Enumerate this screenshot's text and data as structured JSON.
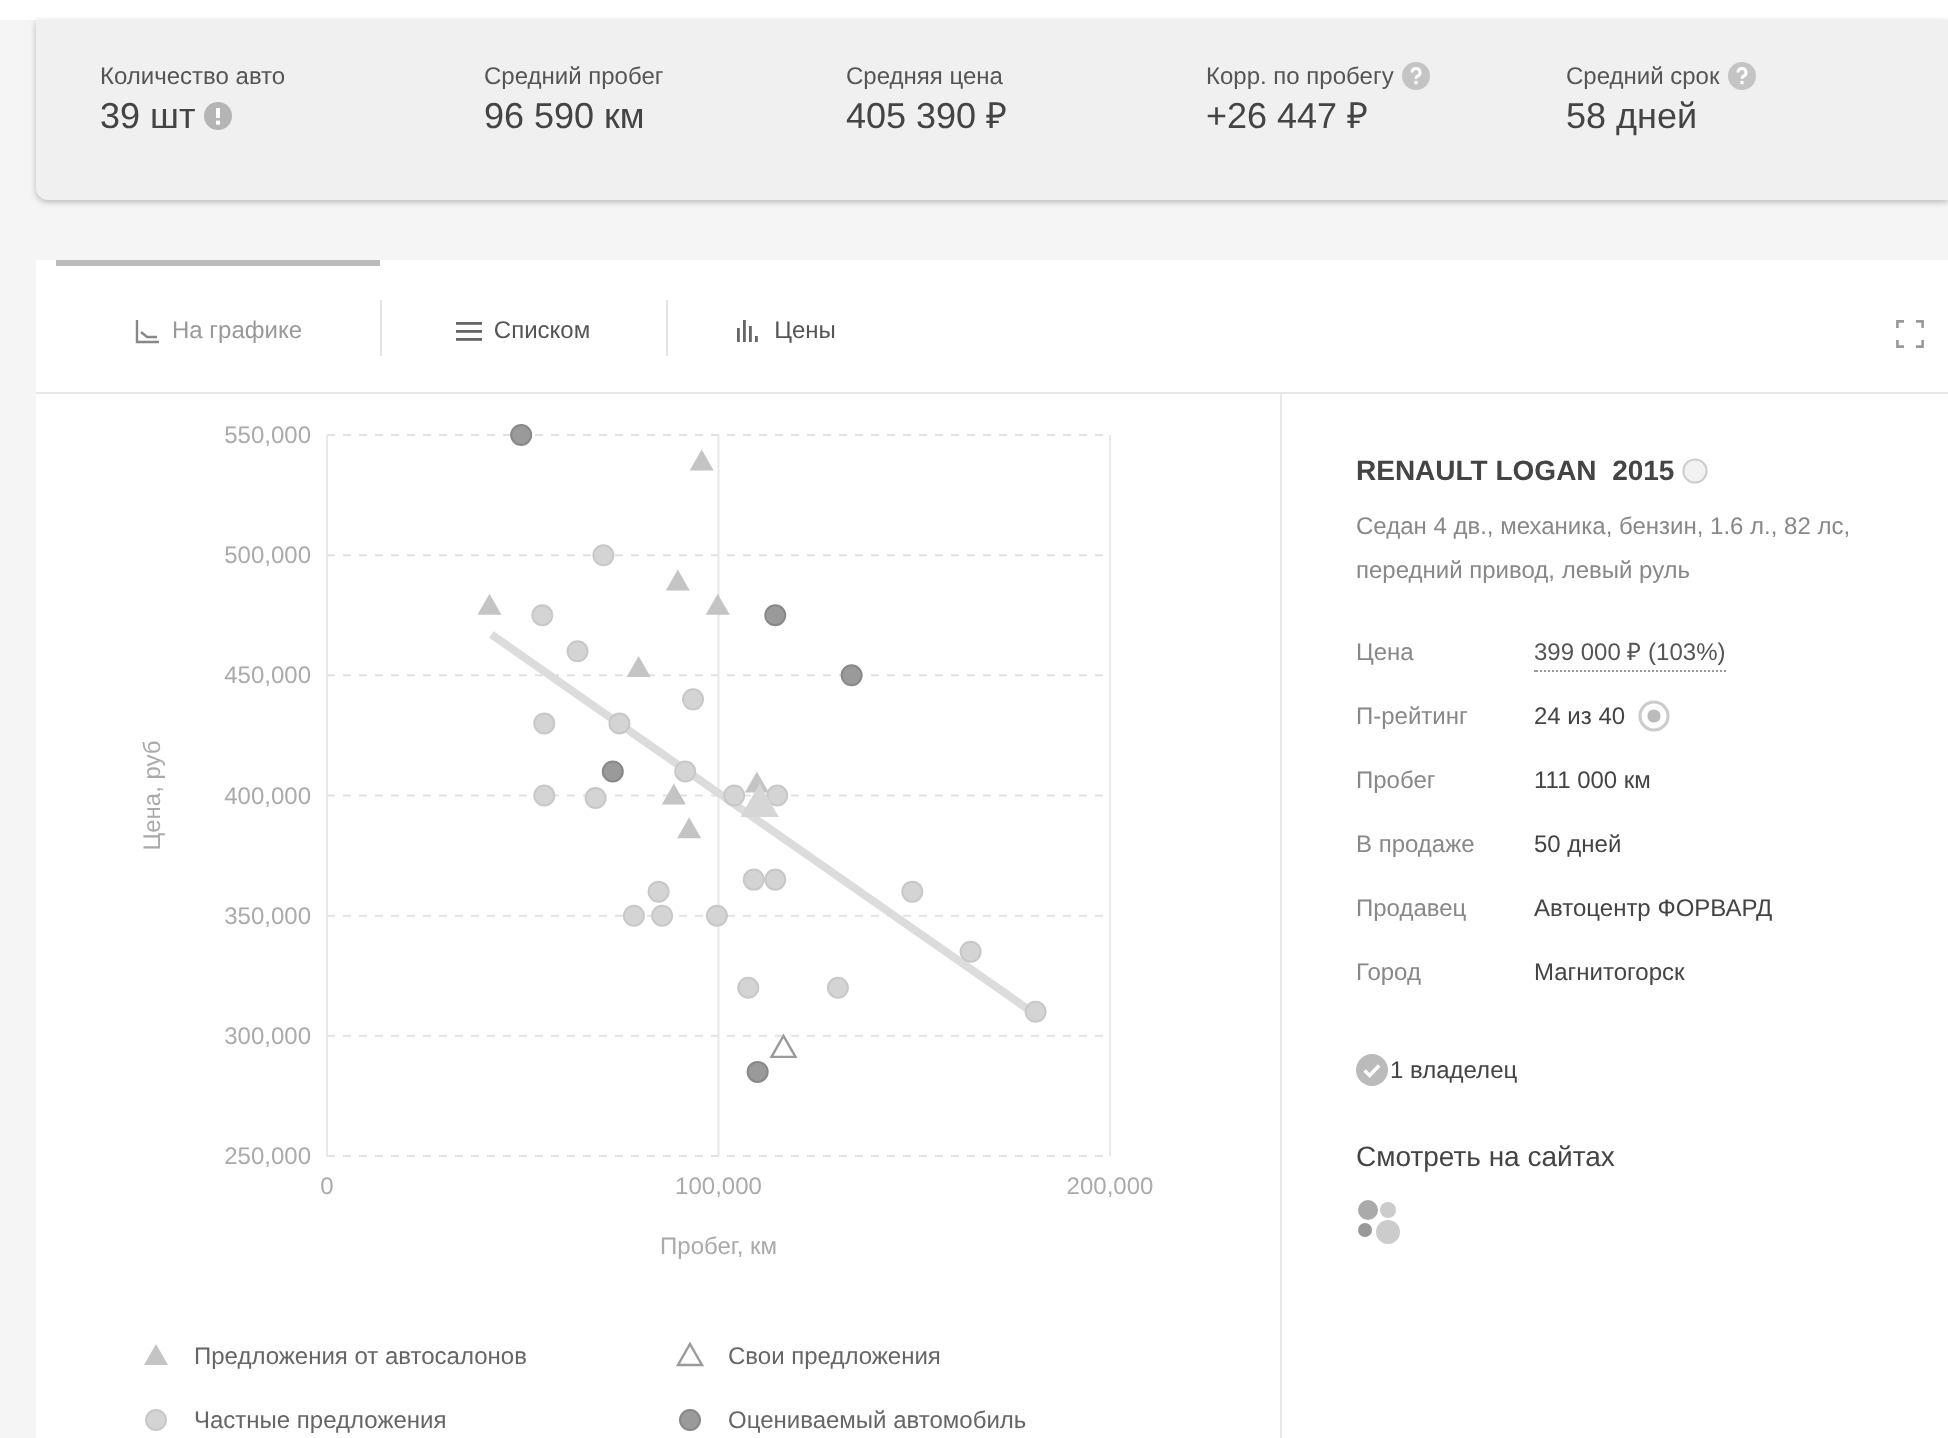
{
  "stats": [
    {
      "label": "Количество авто",
      "value": "39 шт"
    },
    {
      "label": "Средний пробег",
      "value": "96 590 км"
    },
    {
      "label": "Средняя цена",
      "value": "405 390 ₽"
    },
    {
      "label": "Корр. по пробегу",
      "value": "+26 447 ₽"
    },
    {
      "label": "Средний срок",
      "value": "58 дней"
    }
  ],
  "tabs": [
    {
      "label": "На графике",
      "selected": true
    },
    {
      "label": "Списком",
      "selected": false
    },
    {
      "label": "Цены",
      "selected": false
    }
  ],
  "chart": {
    "chart_data": {
      "type": "scatter",
      "xlabel": "Пробег, км",
      "ylabel": "Цена, руб",
      "xlim": [
        0,
        200000
      ],
      "ylim": [
        250000,
        550000
      ],
      "xticks": [
        {
          "value": 0,
          "label": "0"
        },
        {
          "value": 100000,
          "label": "100,000"
        },
        {
          "value": 200000,
          "label": "200,000"
        }
      ],
      "yticks": [
        {
          "value": 250000,
          "label": "250,000"
        },
        {
          "value": 300000,
          "label": "300,000"
        },
        {
          "value": 350000,
          "label": "350,000"
        },
        {
          "value": 400000,
          "label": "400,000"
        },
        {
          "value": 450000,
          "label": "450,000"
        },
        {
          "value": 500000,
          "label": "500,000"
        },
        {
          "value": 550000,
          "label": "550,000"
        }
      ],
      "series": [
        {
          "name": "Предложения от автосалонов",
          "color": "#c4c4c4",
          "x": [
            95700,
            41500,
            89600,
            99800,
            79600,
            88600,
            92500,
            109800
          ],
          "values": [
            539000,
            479000,
            489000,
            479000,
            453000,
            400000,
            386000,
            405000
          ]
        },
        {
          "name": "Свои предложения",
          "color": "#9a9a9a",
          "x": [
            116600
          ],
          "values": [
            295000
          ]
        },
        {
          "name": "Частные предложения",
          "color": "#d4d4d4",
          "x": [
            70600,
            55000,
            64000,
            55500,
            74700,
            93500,
            91500,
            55500,
            68600,
            104000,
            115000,
            109000,
            114500,
            84700,
            78400,
            85600,
            99600,
            149500,
            164400,
            107600,
            130500,
            181000
          ],
          "values": [
            500000,
            475000,
            460000,
            430000,
            430000,
            440000,
            410000,
            400000,
            399000,
            400000,
            400000,
            365000,
            365000,
            360000,
            350000,
            350000,
            350000,
            360000,
            335000,
            320000,
            320000,
            310000
          ]
        },
        {
          "name": "Оцениваемый автомобиль",
          "color": "#9a9a9a",
          "x": [
            49600,
            114500,
            134000,
            73000,
            110000
          ],
          "values": [
            550000,
            475000,
            450000,
            410000,
            285000
          ]
        },
        {
          "type": "line",
          "color": "#dcdcdc",
          "x": [
            42000,
            180000
          ],
          "values": [
            467000,
            310000
          ]
        },
        {
          "color": "#d6d6d6",
          "x": [
            110500
          ],
          "values": [
            397000
          ]
        }
      ],
      "grid": "y",
      "ref_lines": [
        {
          "axis": "x",
          "value": 100000
        }
      ],
      "legend": "bottom"
    }
  },
  "car": {
    "title": "RENAULT LOGAN  2015",
    "description": "Седан 4 дв., механика, бензин, 1.6 л., 82 лс, передний привод, левый руль",
    "specs": [
      {
        "label": "Цена",
        "value": "399 000 ₽ (103%)",
        "kind": "price"
      },
      {
        "label": "П-рейтинг",
        "value": "24 из 40",
        "kind": "rating"
      },
      {
        "label": "Пробег",
        "value": "111 000 км",
        "kind": "plain"
      },
      {
        "label": "В продаже",
        "value": "50 дней",
        "kind": "plain"
      },
      {
        "label": "Продавец",
        "value": "Автоцентр ФОРВАРД",
        "kind": "plain"
      },
      {
        "label": "Город",
        "value": "Магнитогорск",
        "kind": "plain"
      }
    ],
    "owners": "1 владелец",
    "sites_heading": "Смотреть на сайтах"
  }
}
